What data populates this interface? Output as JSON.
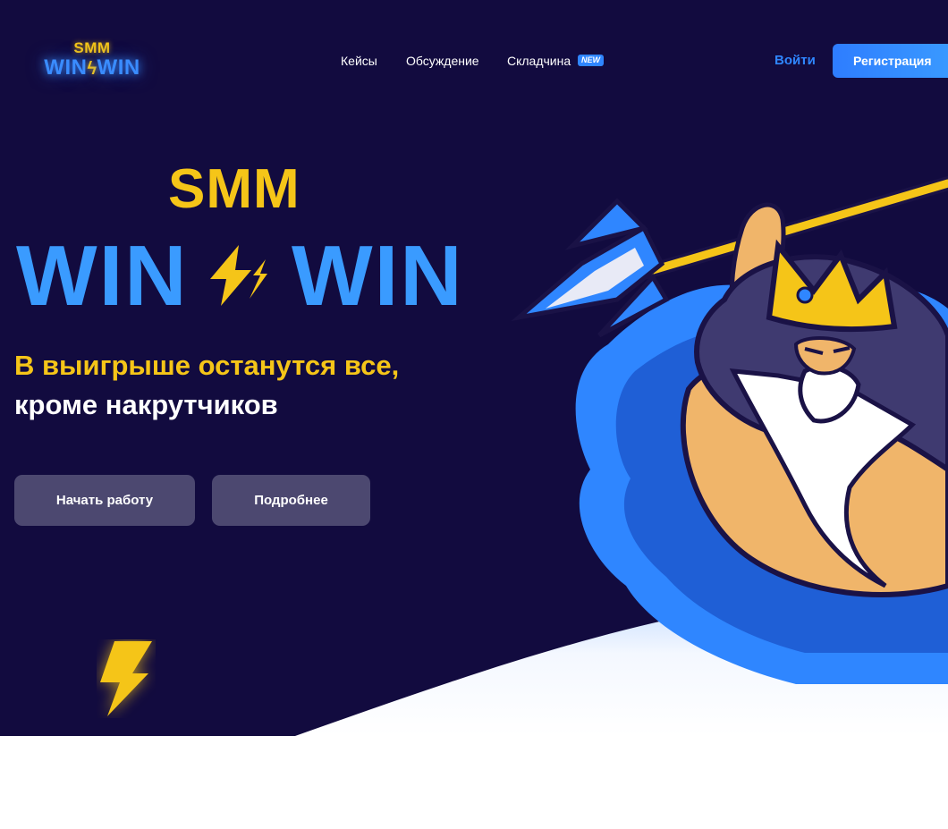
{
  "header": {
    "logo_smm": "SMM",
    "logo_win_left": "WIN",
    "logo_win_right": "WIN",
    "nav": [
      {
        "label": "Кейсы"
      },
      {
        "label": "Обсуждение"
      },
      {
        "label": "Складчина",
        "badge": "NEW"
      }
    ],
    "login_label": "Войти",
    "register_label": "Регистрация"
  },
  "hero": {
    "smm": "SMM",
    "win_left": "WIN",
    "win_right": "WIN",
    "tagline_line1": "В выигрыше останутся все,",
    "tagline_line2": "кроме накрутчиков",
    "start_button": "Начать работу",
    "more_button": "Подробнее"
  },
  "colors": {
    "background": "#120b3f",
    "accent_yellow": "#f5c518",
    "accent_blue": "#2f86ff",
    "button_muted": "#4c4870"
  },
  "icons": [
    "lightning-bolt-icon",
    "trident-icon"
  ]
}
